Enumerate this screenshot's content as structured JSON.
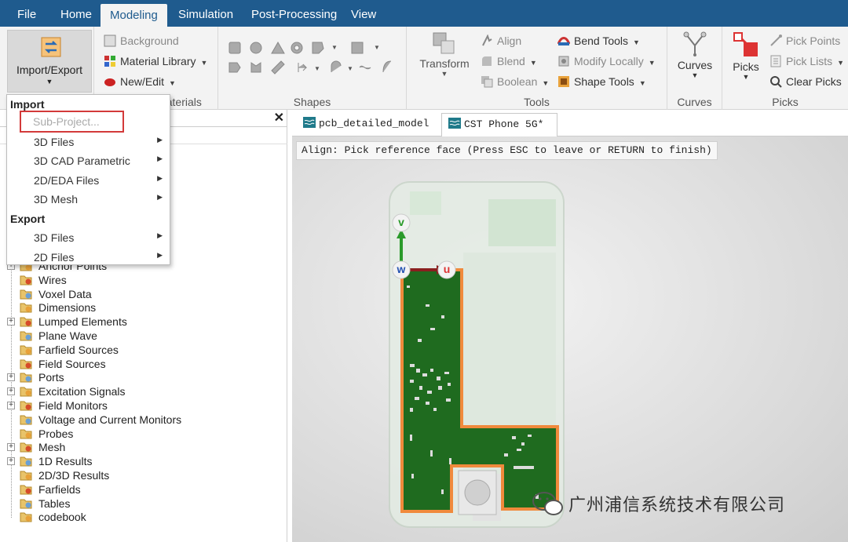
{
  "menubar": {
    "items": [
      "File",
      "Home",
      "Modeling",
      "Simulation",
      "Post-Processing",
      "View"
    ],
    "active": "Modeling"
  },
  "ribbon": {
    "import_export_label": "Import/Export",
    "materials": {
      "background": "Background",
      "material_library": "Material Library",
      "new_edit": "New/Edit",
      "group_label": "Materials"
    },
    "shapes": {
      "group_label": "Shapes"
    },
    "tools": {
      "transform": "Transform",
      "align": "Align",
      "blend": "Blend",
      "boolean": "Boolean",
      "bend_tools": "Bend Tools",
      "modify_locally": "Modify Locally",
      "shape_tools": "Shape Tools",
      "group_label": "Tools"
    },
    "curves": {
      "curves_btn": "Curves",
      "group_label": "Curves"
    },
    "picks": {
      "picks_btn": "Picks",
      "pick_points": "Pick Points",
      "pick_lists": "Pick Lists",
      "clear_picks": "Clear Picks",
      "group_label": "Picks"
    }
  },
  "dropdown": {
    "import_header": "Import",
    "sub_project": "Sub-Project...",
    "import_items": [
      "3D Files",
      "3D CAD Parametric",
      "2D/EDA Files",
      "3D Mesh"
    ],
    "export_header": "Export",
    "export_items": [
      "3D Files",
      "2D Files"
    ]
  },
  "tree": {
    "items": [
      {
        "label": "Anchor Points",
        "expandable": true
      },
      {
        "label": "Wires",
        "expandable": false
      },
      {
        "label": "Voxel Data",
        "expandable": false
      },
      {
        "label": "Dimensions",
        "expandable": false
      },
      {
        "label": "Lumped Elements",
        "expandable": true
      },
      {
        "label": "Plane Wave",
        "expandable": false
      },
      {
        "label": "Farfield Sources",
        "expandable": false
      },
      {
        "label": "Field Sources",
        "expandable": false
      },
      {
        "label": "Ports",
        "expandable": true
      },
      {
        "label": "Excitation Signals",
        "expandable": true
      },
      {
        "label": "Field Monitors",
        "expandable": true
      },
      {
        "label": "Voltage and Current Monitors",
        "expandable": false
      },
      {
        "label": "Probes",
        "expandable": false
      },
      {
        "label": "Mesh",
        "expandable": true
      },
      {
        "label": "1D Results",
        "expandable": true
      },
      {
        "label": "2D/3D Results",
        "expandable": false
      },
      {
        "label": "Farfields",
        "expandable": false
      },
      {
        "label": "Tables",
        "expandable": false
      },
      {
        "label": "codebook",
        "expandable": false
      }
    ]
  },
  "tabs": [
    {
      "label": "pcb_detailed_model",
      "active": false
    },
    {
      "label": "CST Phone 5G*",
      "active": true
    }
  ],
  "viewport": {
    "status_text": "Align: Pick reference face (Press ESC to leave or RETURN to finish)",
    "axis_v": "v",
    "axis_w": "w",
    "axis_u": "u"
  },
  "watermark": "广州浦信系统技术有限公司",
  "colors": {
    "menubar": "#1f5b8e",
    "pcb_green": "#1f6b1f",
    "pcb_outline": "#f08a3c",
    "tab_close_active": "#e0463c"
  }
}
